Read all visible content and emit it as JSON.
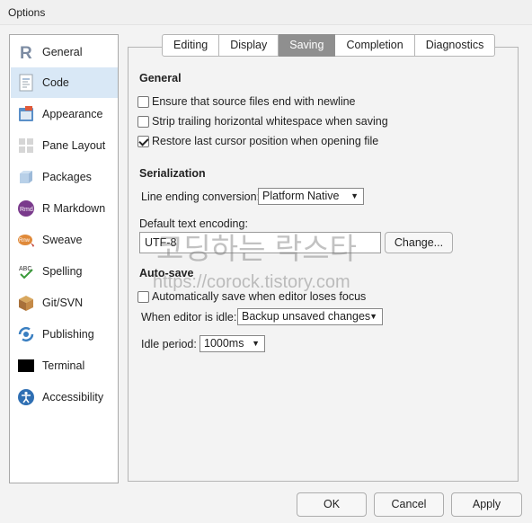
{
  "window": {
    "title": "Options"
  },
  "sidebar": {
    "items": [
      {
        "label": "General",
        "icon": "r-logo-icon"
      },
      {
        "label": "Code",
        "icon": "code-document-icon",
        "active": true
      },
      {
        "label": "Appearance",
        "icon": "appearance-icon"
      },
      {
        "label": "Pane Layout",
        "icon": "pane-layout-icon"
      },
      {
        "label": "Packages",
        "icon": "packages-icon"
      },
      {
        "label": "R Markdown",
        "icon": "rmd-icon"
      },
      {
        "label": "Sweave",
        "icon": "sweave-icon"
      },
      {
        "label": "Spelling",
        "icon": "spelling-icon"
      },
      {
        "label": "Git/SVN",
        "icon": "git-box-icon"
      },
      {
        "label": "Publishing",
        "icon": "publishing-icon"
      },
      {
        "label": "Terminal",
        "icon": "terminal-icon"
      },
      {
        "label": "Accessibility",
        "icon": "accessibility-icon"
      }
    ]
  },
  "tabs": [
    "Editing",
    "Display",
    "Saving",
    "Completion",
    "Diagnostics"
  ],
  "active_tab": "Saving",
  "general": {
    "title": "General",
    "options": [
      {
        "label": "Ensure that source files end with newline",
        "checked": false
      },
      {
        "label": "Strip trailing horizontal whitespace when saving",
        "checked": false
      },
      {
        "label": "Restore last cursor position when opening file",
        "checked": true
      }
    ]
  },
  "serialization": {
    "title": "Serialization",
    "line_ending_label": "Line ending conversion:",
    "line_ending_value": "Platform Native",
    "encoding_label": "Default text encoding:",
    "encoding_value": "UTF-8",
    "change_button": "Change..."
  },
  "autosave": {
    "title": "Auto-save",
    "auto_save_label": "Automatically save when editor loses focus",
    "auto_save_checked": false,
    "idle_label": "When editor is idle:",
    "idle_value": "Backup unsaved changes",
    "idle_period_label": "Idle period:",
    "idle_period_value": "1000ms"
  },
  "footer": {
    "ok": "OK",
    "cancel": "Cancel",
    "apply": "Apply"
  },
  "watermark": {
    "line1": "코딩하는 락스타",
    "line2": "https://corock.tistory.com"
  },
  "colors": {
    "active_tab": "#8f8f8f",
    "active_sidebar": "#d9e8f6",
    "rstudio_blue": "#3a7fc1"
  }
}
